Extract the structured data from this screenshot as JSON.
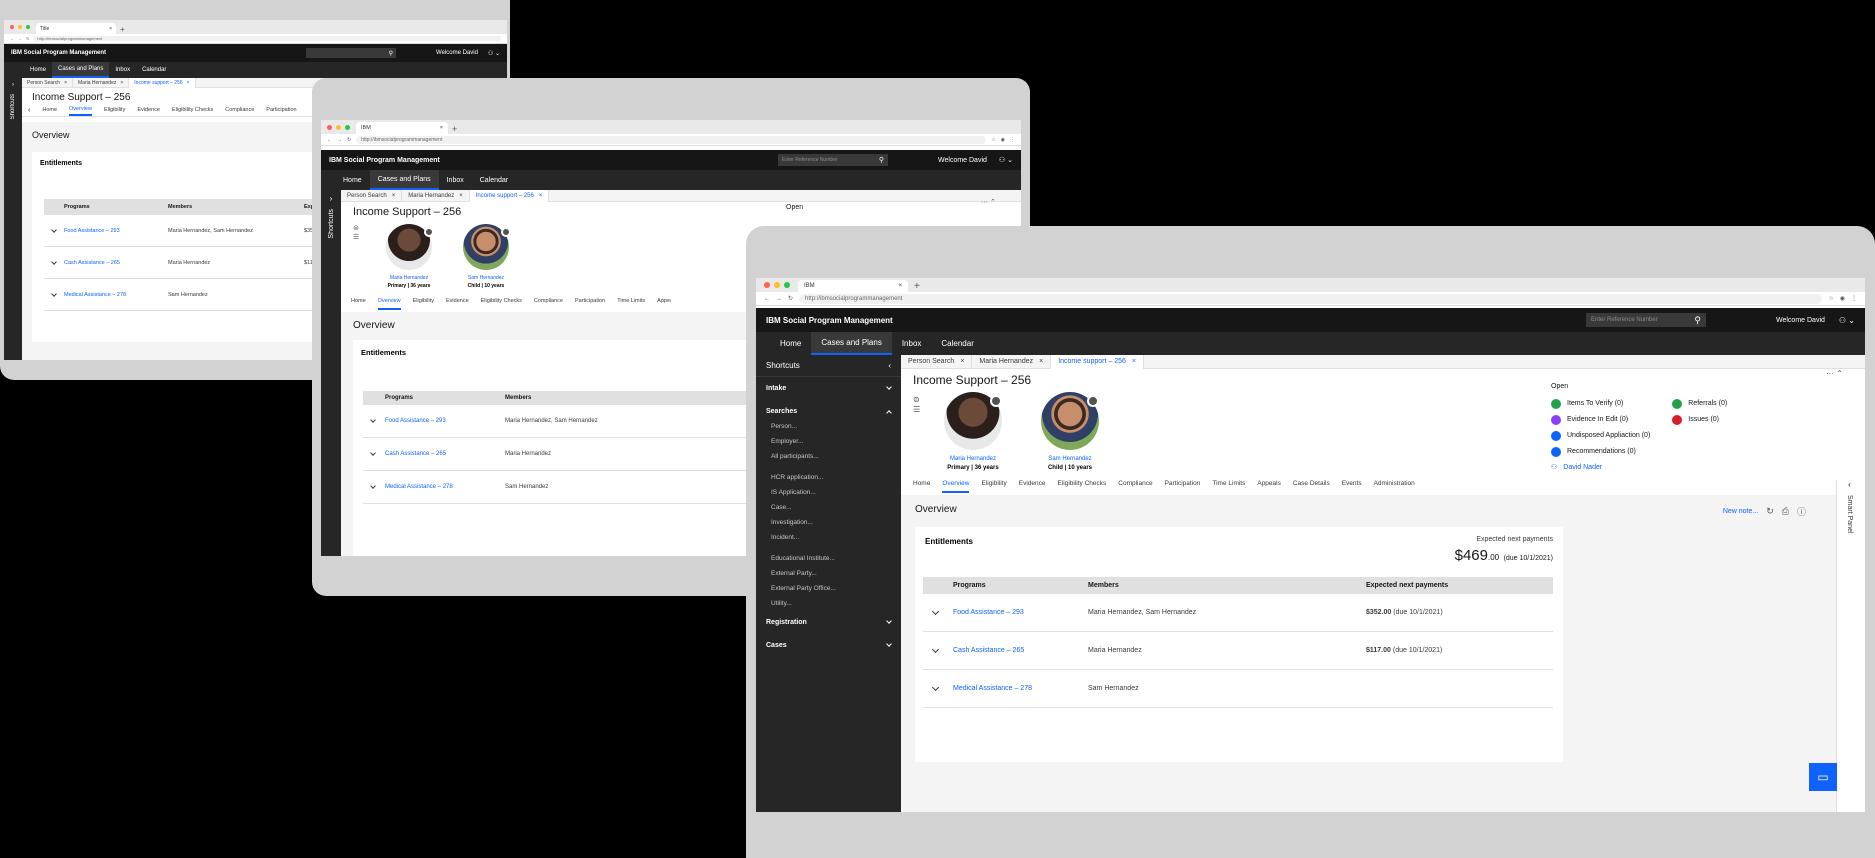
{
  "browser": {
    "tab_title": "IBM",
    "tab_title_small": "Title",
    "url": "http://ibmsocialprogrammanagement"
  },
  "app": {
    "brand_prefix": "IBM",
    "brand_name": "Social Program Management",
    "search_placeholder": "Enter Reference Number",
    "welcome": "Welcome David",
    "nav": [
      "Home",
      "Cases and Plans",
      "Inbox",
      "Calendar"
    ],
    "active_nav": "Cases and Plans"
  },
  "case_tabs": [
    {
      "label": "Person Search"
    },
    {
      "label": "Maria Hernandez"
    },
    {
      "label": "Income support – 256"
    }
  ],
  "page": {
    "title": "Income Support – 256",
    "overview_title": "Overview",
    "new_note": "New note...",
    "smart_panel": "Smart Panel",
    "shortcuts": "Shortcuts"
  },
  "people": [
    {
      "name": "Maria Hernandez",
      "role": "Primary | 36 years"
    },
    {
      "name": "Sam Hernandez",
      "role": "Child | 10 years"
    }
  ],
  "open_panel": {
    "title": "Open",
    "items_left": [
      "Items To Verify (0)",
      "Evidence In Edit (0)",
      "Undisposed Appliaction (0)",
      "Recommendations (0)"
    ],
    "items_right": [
      "Referrals (0)",
      "Issues (0)"
    ],
    "owner": "David Nader",
    "colors": {
      "verify": "#24a148",
      "evidence": "#8a3ffc",
      "undisposed": "#0f62fe",
      "recommend": "#0f62fe",
      "referrals": "#24a148",
      "issues": "#da1e28"
    }
  },
  "subtabs": [
    "Home",
    "Overview",
    "Eligibility",
    "Evidence",
    "Eligibility Checks",
    "Compliance",
    "Participation",
    "Time Limits",
    "Appeals",
    "Case Details",
    "Events",
    "Administration"
  ],
  "active_subtab": "Overview",
  "entitlements": {
    "title": "Entitlements",
    "expected_label": "Expected next payments",
    "total_main": "$469",
    "total_cents": ".00",
    "total_due": "(due 10/1/2021)",
    "columns": [
      "Programs",
      "Members",
      "Expected next payments"
    ],
    "rows": [
      {
        "program": "Food Assistance – 293",
        "members": "Maria Hernandez, Sam Hernandez",
        "amount": "$352.00",
        "due": "(due 10/1/2021)"
      },
      {
        "program": "Cash Assistance – 265",
        "members": "Maria Hernandez",
        "amount": "$117.00",
        "due": "(due 10/1/2021)"
      },
      {
        "program": "Medical Assistance – 278",
        "members": "Sam Hernandez",
        "amount": "",
        "due": ""
      }
    ]
  },
  "sidebar": {
    "sections": [
      {
        "label": "Intake",
        "expanded": false
      },
      {
        "label": "Searches",
        "expanded": true
      },
      {
        "label": "Registration",
        "expanded": false
      },
      {
        "label": "Cases",
        "expanded": false
      }
    ],
    "search_items_1": [
      "Person...",
      "Employer...",
      "All participants..."
    ],
    "search_items_2": [
      "HCR application...",
      "IS Application...",
      "Case...",
      "Investigation...",
      "Incident..."
    ],
    "search_items_3": [
      "Educational Institute...",
      "External Party...",
      "External Party Office...",
      "Utility..."
    ]
  },
  "colors": {
    "accent": "#0f62fe",
    "header": "#161616",
    "nav": "#262626"
  }
}
